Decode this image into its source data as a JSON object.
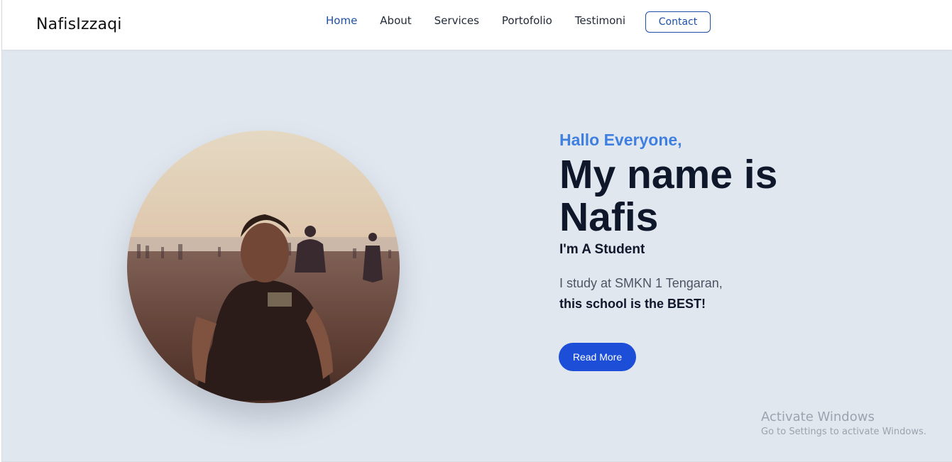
{
  "brand": "NafisIzzaqi",
  "nav": {
    "items": [
      "Home",
      "About",
      "Services",
      "Portofolio",
      "Testimoni"
    ],
    "contact": "Contact"
  },
  "hero": {
    "greeting": "Hallo Everyone,",
    "headline": "My name is Nafis",
    "role": "I'm A Student",
    "study": "I study at SMKN 1 Tengaran,",
    "best": "this school is the BEST!",
    "button": "Read More",
    "photo_subject": "person-at-beach-photo"
  },
  "watermark": {
    "title": "Activate Windows",
    "subtitle": "Go to Settings to activate Windows."
  },
  "colors": {
    "accent": "#1d4ed8",
    "greeting": "#3f7fe0",
    "hero_bg": "#e1e7ef",
    "heading": "#0f172a"
  }
}
